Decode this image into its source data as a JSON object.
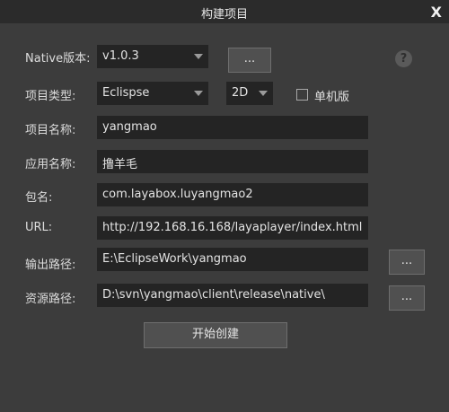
{
  "window": {
    "title": "构建项目",
    "close_label": "X"
  },
  "labels": {
    "native_version": "Native版本:",
    "project_type": "项目类型:",
    "project_name": "项目名称:",
    "app_name": "应用名称:",
    "package_name": "包名:",
    "url": "URL:",
    "output_path": "输出路径:",
    "resource_path": "资源路径:"
  },
  "fields": {
    "native_version": "v1.0.3",
    "project_type": "Eclispse",
    "dimension": "2D",
    "project_name": "yangmao",
    "app_name": "撸羊毛",
    "package_name": "com.layabox.luyangmao2",
    "url": "http://192.168.16.168/layaplayer/index.html",
    "output_path": "E:\\EclipseWork\\yangmao",
    "resource_path": "D:\\svn\\yangmao\\client\\release\\native\\"
  },
  "buttons": {
    "native_browse": "...",
    "output_browse": "...",
    "resource_browse": "...",
    "start_build": "开始创建"
  },
  "help_label": "?",
  "standalone": {
    "label": "单机版",
    "checked": false
  }
}
